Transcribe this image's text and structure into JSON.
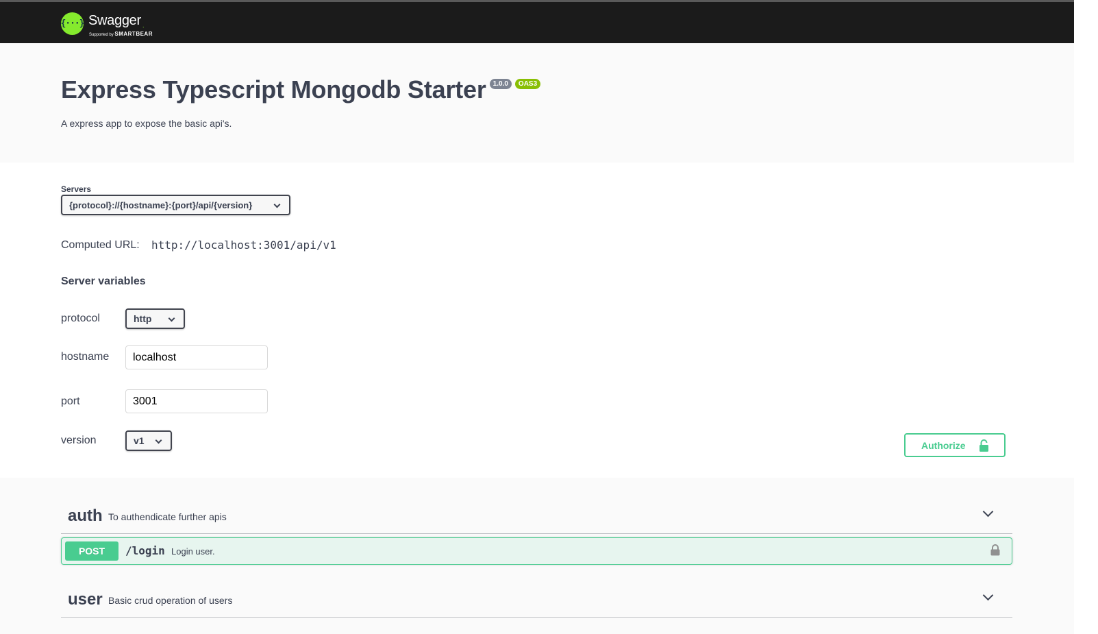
{
  "topbar": {
    "logo_glyph": "{···}",
    "logo_name": "Swagger",
    "logo_supported": "Supported by",
    "logo_brand": "SMARTBEAR",
    "logo_color": "#85ea2d",
    "background": "#1b1b1b"
  },
  "info": {
    "title": "Express Typescript Mongodb Starter",
    "version_badge": "1.0.0",
    "oas_badge": "OAS3",
    "description": "A express app to expose the basic api's."
  },
  "servers": {
    "label": "Servers",
    "selected": "{protocol}://{hostname}:{port}/api/{version}",
    "computed_label": "Computed URL:",
    "computed_url": "http://localhost:3001/api/v1",
    "variables_title": "Server variables",
    "variables": {
      "protocol": {
        "label": "protocol",
        "value": "http"
      },
      "hostname": {
        "label": "hostname",
        "value": "localhost"
      },
      "port": {
        "label": "port",
        "value": "3001"
      },
      "version": {
        "label": "version",
        "value": "v1"
      }
    }
  },
  "authorize": {
    "label": "Authorize",
    "icon": "unlocked-lock-icon",
    "color": "#49cc90"
  },
  "tags": [
    {
      "name": "auth",
      "description": "To authendicate further apis",
      "operations": [
        {
          "method": "POST",
          "path": "/login",
          "summary": "Login user.",
          "color": "#49cc90",
          "icon": "lock-icon"
        }
      ]
    },
    {
      "name": "user",
      "description": "Basic crud operation of users"
    }
  ]
}
